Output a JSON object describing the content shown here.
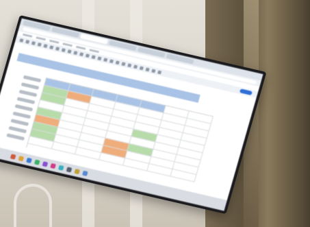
{
  "scene": {
    "description_free": true
  },
  "screen": {
    "tab_count": 6,
    "toolbar_icon_count": 24,
    "grid": {
      "columns": 7,
      "rows": 9,
      "cell_colors": [
        [
          "h",
          "h",
          "h",
          "h",
          "h",
          "w",
          "w"
        ],
        [
          "g",
          "o",
          "w",
          "w",
          "w",
          "w",
          "w"
        ],
        [
          "g",
          "w",
          "w",
          "w",
          "w",
          "w",
          "w"
        ],
        [
          "w",
          "w",
          "w",
          "w",
          "w",
          "w",
          "w"
        ],
        [
          "g",
          "w",
          "w",
          "w",
          "g",
          "w",
          "w"
        ],
        [
          "o",
          "w",
          "w",
          "w",
          "w",
          "w",
          "w"
        ],
        [
          "g",
          "w",
          "w",
          "o",
          "g",
          "w",
          "w"
        ],
        [
          "g",
          "w",
          "w",
          "o",
          "w",
          "w",
          "w"
        ],
        [
          "w",
          "w",
          "w",
          "w",
          "w",
          "w",
          "w"
        ]
      ]
    },
    "taskbar_icon_colors": [
      "#d05a3c",
      "#e0a23a",
      "#3c7ad0",
      "#3cb06a",
      "#8a4fd0",
      "#d03c8a",
      "#3cb0c0",
      "#555d6a",
      "#c0a03c",
      "#5a8ad0"
    ],
    "accent_colors": {
      "header_blue": "#a9c3e6",
      "fill_green": "#b7dcaa",
      "fill_orange": "#f0ad7c",
      "share_blue": "#2f6fd6"
    }
  }
}
